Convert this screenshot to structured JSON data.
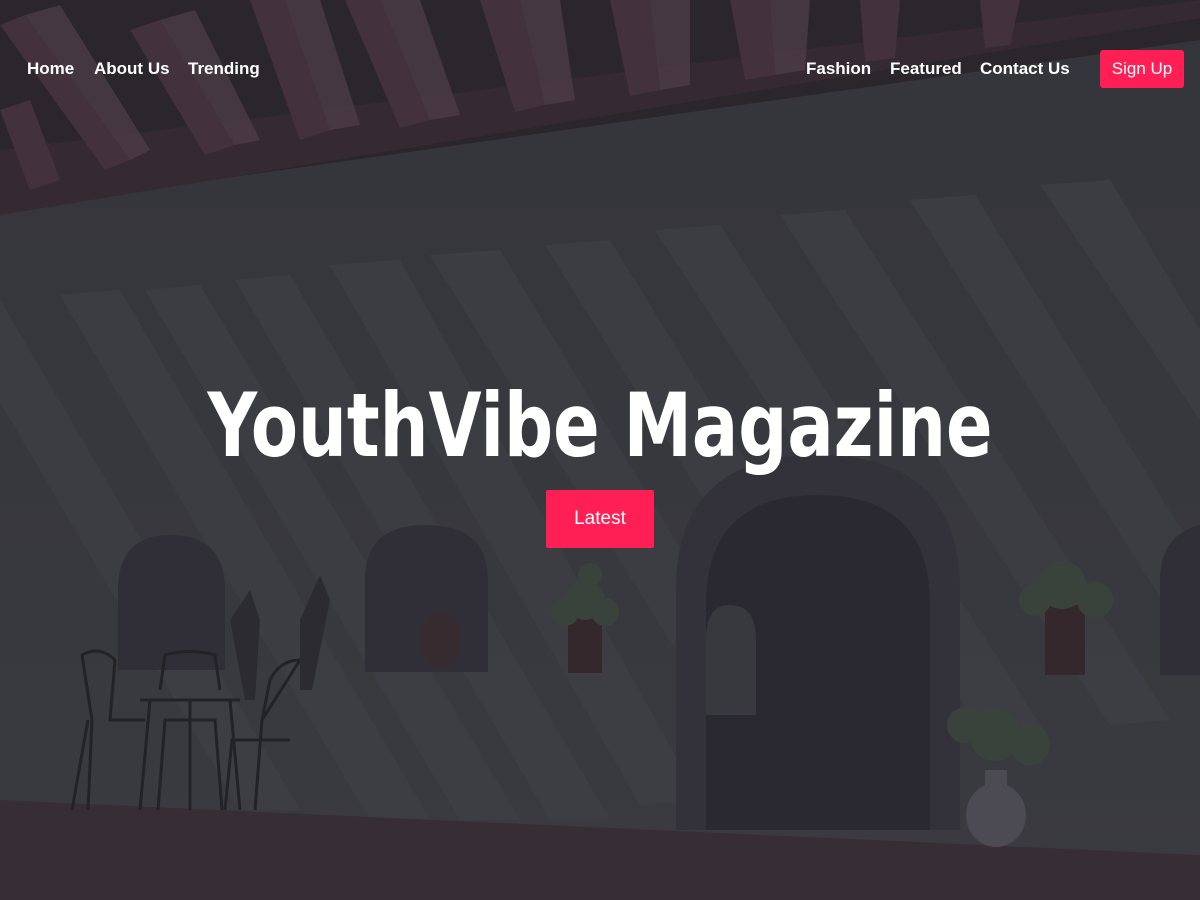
{
  "nav": {
    "left_links": [
      "Home",
      "About Us",
      "Trending"
    ],
    "right_links": [
      "Fashion",
      "Featured",
      "Contact Us"
    ],
    "signup_label": "Sign Up"
  },
  "hero": {
    "title": "YouthVibe Magazine",
    "cta_label": "Latest",
    "background_icon": "courtyard-photo"
  },
  "colors": {
    "accent": "#ff1f55",
    "text": "#ffffff",
    "background": "#3c3d42"
  }
}
